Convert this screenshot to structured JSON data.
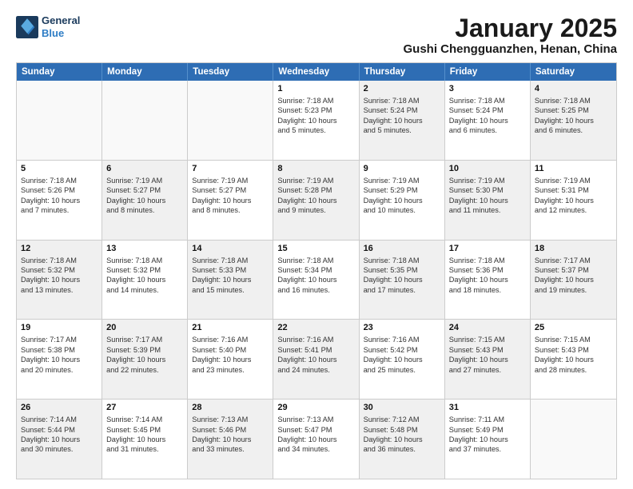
{
  "logo": {
    "line1": "General",
    "line2": "Blue"
  },
  "title": "January 2025",
  "location": "Gushi Chengguanzhen, Henan, China",
  "weekdays": [
    "Sunday",
    "Monday",
    "Tuesday",
    "Wednesday",
    "Thursday",
    "Friday",
    "Saturday"
  ],
  "rows": [
    [
      {
        "day": "",
        "info": "",
        "shaded": false,
        "empty": true
      },
      {
        "day": "",
        "info": "",
        "shaded": false,
        "empty": true
      },
      {
        "day": "",
        "info": "",
        "shaded": false,
        "empty": true
      },
      {
        "day": "1",
        "info": "Sunrise: 7:18 AM\nSunset: 5:23 PM\nDaylight: 10 hours\nand 5 minutes.",
        "shaded": false,
        "empty": false
      },
      {
        "day": "2",
        "info": "Sunrise: 7:18 AM\nSunset: 5:24 PM\nDaylight: 10 hours\nand 5 minutes.",
        "shaded": true,
        "empty": false
      },
      {
        "day": "3",
        "info": "Sunrise: 7:18 AM\nSunset: 5:24 PM\nDaylight: 10 hours\nand 6 minutes.",
        "shaded": false,
        "empty": false
      },
      {
        "day": "4",
        "info": "Sunrise: 7:18 AM\nSunset: 5:25 PM\nDaylight: 10 hours\nand 6 minutes.",
        "shaded": true,
        "empty": false
      }
    ],
    [
      {
        "day": "5",
        "info": "Sunrise: 7:18 AM\nSunset: 5:26 PM\nDaylight: 10 hours\nand 7 minutes.",
        "shaded": false,
        "empty": false
      },
      {
        "day": "6",
        "info": "Sunrise: 7:19 AM\nSunset: 5:27 PM\nDaylight: 10 hours\nand 8 minutes.",
        "shaded": true,
        "empty": false
      },
      {
        "day": "7",
        "info": "Sunrise: 7:19 AM\nSunset: 5:27 PM\nDaylight: 10 hours\nand 8 minutes.",
        "shaded": false,
        "empty": false
      },
      {
        "day": "8",
        "info": "Sunrise: 7:19 AM\nSunset: 5:28 PM\nDaylight: 10 hours\nand 9 minutes.",
        "shaded": true,
        "empty": false
      },
      {
        "day": "9",
        "info": "Sunrise: 7:19 AM\nSunset: 5:29 PM\nDaylight: 10 hours\nand 10 minutes.",
        "shaded": false,
        "empty": false
      },
      {
        "day": "10",
        "info": "Sunrise: 7:19 AM\nSunset: 5:30 PM\nDaylight: 10 hours\nand 11 minutes.",
        "shaded": true,
        "empty": false
      },
      {
        "day": "11",
        "info": "Sunrise: 7:19 AM\nSunset: 5:31 PM\nDaylight: 10 hours\nand 12 minutes.",
        "shaded": false,
        "empty": false
      }
    ],
    [
      {
        "day": "12",
        "info": "Sunrise: 7:18 AM\nSunset: 5:32 PM\nDaylight: 10 hours\nand 13 minutes.",
        "shaded": true,
        "empty": false
      },
      {
        "day": "13",
        "info": "Sunrise: 7:18 AM\nSunset: 5:32 PM\nDaylight: 10 hours\nand 14 minutes.",
        "shaded": false,
        "empty": false
      },
      {
        "day": "14",
        "info": "Sunrise: 7:18 AM\nSunset: 5:33 PM\nDaylight: 10 hours\nand 15 minutes.",
        "shaded": true,
        "empty": false
      },
      {
        "day": "15",
        "info": "Sunrise: 7:18 AM\nSunset: 5:34 PM\nDaylight: 10 hours\nand 16 minutes.",
        "shaded": false,
        "empty": false
      },
      {
        "day": "16",
        "info": "Sunrise: 7:18 AM\nSunset: 5:35 PM\nDaylight: 10 hours\nand 17 minutes.",
        "shaded": true,
        "empty": false
      },
      {
        "day": "17",
        "info": "Sunrise: 7:18 AM\nSunset: 5:36 PM\nDaylight: 10 hours\nand 18 minutes.",
        "shaded": false,
        "empty": false
      },
      {
        "day": "18",
        "info": "Sunrise: 7:17 AM\nSunset: 5:37 PM\nDaylight: 10 hours\nand 19 minutes.",
        "shaded": true,
        "empty": false
      }
    ],
    [
      {
        "day": "19",
        "info": "Sunrise: 7:17 AM\nSunset: 5:38 PM\nDaylight: 10 hours\nand 20 minutes.",
        "shaded": false,
        "empty": false
      },
      {
        "day": "20",
        "info": "Sunrise: 7:17 AM\nSunset: 5:39 PM\nDaylight: 10 hours\nand 22 minutes.",
        "shaded": true,
        "empty": false
      },
      {
        "day": "21",
        "info": "Sunrise: 7:16 AM\nSunset: 5:40 PM\nDaylight: 10 hours\nand 23 minutes.",
        "shaded": false,
        "empty": false
      },
      {
        "day": "22",
        "info": "Sunrise: 7:16 AM\nSunset: 5:41 PM\nDaylight: 10 hours\nand 24 minutes.",
        "shaded": true,
        "empty": false
      },
      {
        "day": "23",
        "info": "Sunrise: 7:16 AM\nSunset: 5:42 PM\nDaylight: 10 hours\nand 25 minutes.",
        "shaded": false,
        "empty": false
      },
      {
        "day": "24",
        "info": "Sunrise: 7:15 AM\nSunset: 5:43 PM\nDaylight: 10 hours\nand 27 minutes.",
        "shaded": true,
        "empty": false
      },
      {
        "day": "25",
        "info": "Sunrise: 7:15 AM\nSunset: 5:43 PM\nDaylight: 10 hours\nand 28 minutes.",
        "shaded": false,
        "empty": false
      }
    ],
    [
      {
        "day": "26",
        "info": "Sunrise: 7:14 AM\nSunset: 5:44 PM\nDaylight: 10 hours\nand 30 minutes.",
        "shaded": true,
        "empty": false
      },
      {
        "day": "27",
        "info": "Sunrise: 7:14 AM\nSunset: 5:45 PM\nDaylight: 10 hours\nand 31 minutes.",
        "shaded": false,
        "empty": false
      },
      {
        "day": "28",
        "info": "Sunrise: 7:13 AM\nSunset: 5:46 PM\nDaylight: 10 hours\nand 33 minutes.",
        "shaded": true,
        "empty": false
      },
      {
        "day": "29",
        "info": "Sunrise: 7:13 AM\nSunset: 5:47 PM\nDaylight: 10 hours\nand 34 minutes.",
        "shaded": false,
        "empty": false
      },
      {
        "day": "30",
        "info": "Sunrise: 7:12 AM\nSunset: 5:48 PM\nDaylight: 10 hours\nand 36 minutes.",
        "shaded": true,
        "empty": false
      },
      {
        "day": "31",
        "info": "Sunrise: 7:11 AM\nSunset: 5:49 PM\nDaylight: 10 hours\nand 37 minutes.",
        "shaded": false,
        "empty": false
      },
      {
        "day": "",
        "info": "",
        "shaded": true,
        "empty": true
      }
    ]
  ]
}
